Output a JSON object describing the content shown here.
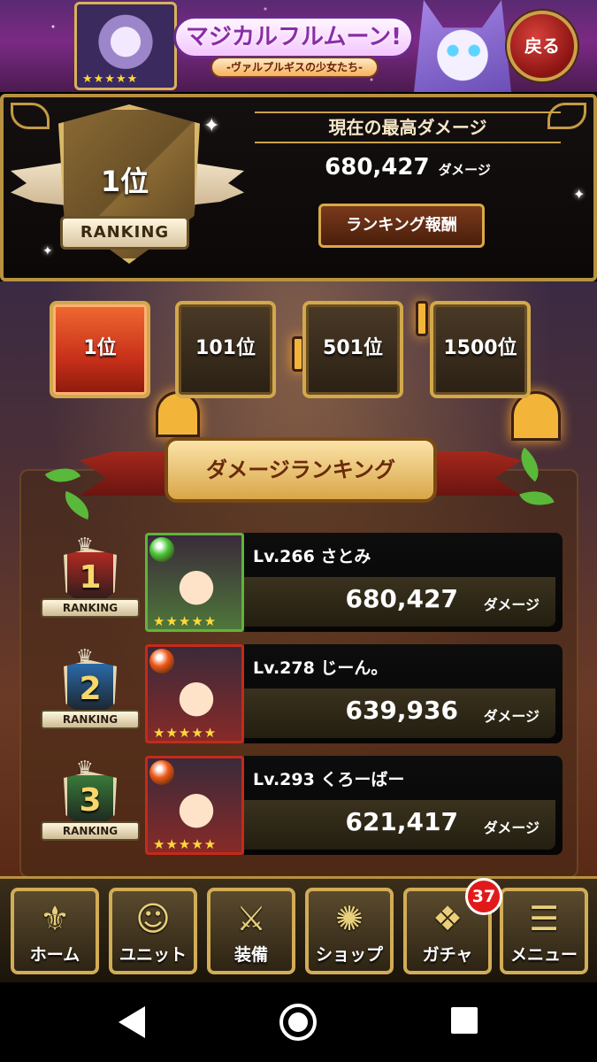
{
  "banner": {
    "title": "マジカルフルムーン!",
    "subtitle": "-ヴァルプルギスの少女たち-",
    "portrait_stars": "★★★★★",
    "back_label": "戻る"
  },
  "rank_header": {
    "rank": "1位",
    "ribbon_label": "RANKING",
    "best_damage_title": "現在の最高ダメージ",
    "best_damage_value": "680,427",
    "damage_unit": "ダメージ",
    "reward_button_label": "ランキング報酬"
  },
  "tiers": [
    {
      "label": "1位",
      "active": true
    },
    {
      "label": "101位",
      "active": false
    },
    {
      "label": "501位",
      "active": false
    },
    {
      "label": "1500位",
      "active": false
    }
  ],
  "list_title": "ダメージランキング",
  "rows": [
    {
      "rank": "1",
      "badge_label": "RANKING",
      "badge_color": "#b02a22",
      "portrait_border": "#5fb43a",
      "element_color": "#4cc93a",
      "element_icon": "wind-element-icon",
      "stars": "★★★★★",
      "player": "Lv.266 さとみ",
      "score": "680,427",
      "unit": "ダメージ"
    },
    {
      "rank": "2",
      "badge_label": "RANKING",
      "badge_color": "#2a6aa8",
      "portrait_border": "#c52a1a",
      "element_color": "#f05a1a",
      "element_icon": "fire-element-icon",
      "stars": "★★★★★",
      "player": "Lv.278 じーん。",
      "score": "639,936",
      "unit": "ダメージ"
    },
    {
      "rank": "3",
      "badge_label": "RANKING",
      "badge_color": "#3a7a3a",
      "portrait_border": "#c52a1a",
      "element_color": "#f05a1a",
      "element_icon": "fire-element-icon",
      "stars": "★★★★★",
      "player": "Lv.293 くろーばー",
      "score": "621,417",
      "unit": "ダメージ"
    }
  ],
  "bottom_nav": [
    {
      "label": "ホーム",
      "icon": "fleur-de-lis-icon",
      "glyph": "⚜"
    },
    {
      "label": "ユニット",
      "icon": "unit-silhouette-icon",
      "glyph": "☺"
    },
    {
      "label": "装備",
      "icon": "crossed-swords-icon",
      "glyph": "⚔"
    },
    {
      "label": "ショップ",
      "icon": "shop-emblem-icon",
      "glyph": "✺"
    },
    {
      "label": "ガチャ",
      "icon": "gacha-cards-icon",
      "glyph": "❖"
    },
    {
      "label": "メニュー",
      "icon": "menu-list-icon",
      "glyph": "☰"
    }
  ],
  "gacha_badge": "37",
  "colors": {
    "gold_border": "#d2a84c",
    "active_tier": "#e0521e",
    "badge_red": "#e01a1a"
  }
}
